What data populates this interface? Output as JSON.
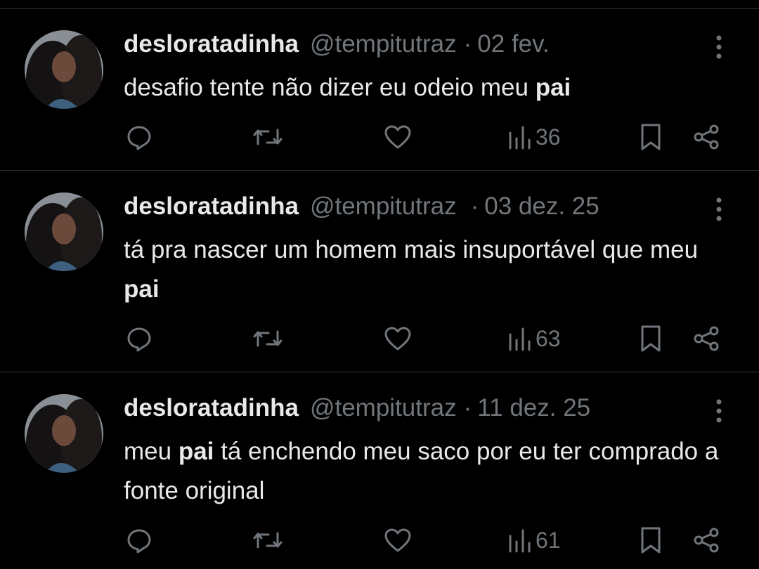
{
  "tweets": [
    {
      "display_name": "desloratadinha",
      "handle": "@tempitutraz",
      "separator": "·",
      "date": "02 fev.",
      "text_parts": [
        "desafio tente não dizer eu odeio meu ",
        "pai",
        ""
      ],
      "views": "36"
    },
    {
      "display_name": "desloratadinha",
      "handle": "@tempitutraz",
      "separator": "·",
      "date": "03 dez. 25",
      "text_parts": [
        "tá pra nascer um homem mais insuportável que meu ",
        "pai",
        ""
      ],
      "views": "63"
    },
    {
      "display_name": "desloratadinha",
      "handle": "@tempitutraz",
      "separator": "·",
      "date": "11 dez. 25",
      "text_parts": [
        "meu ",
        "pai",
        " tá enchendo meu saco por eu ter comprado a fonte original"
      ],
      "views": "61"
    }
  ],
  "icons": {
    "reply": "reply-icon",
    "retweet": "retweet-icon",
    "like": "heart-icon",
    "views": "views-chart-icon",
    "bookmark": "bookmark-icon",
    "share": "share-icon",
    "more": "more-vertical-icon"
  },
  "colors": {
    "background": "#000000",
    "primary_text": "#e7e9ea",
    "secondary_text": "#71767b",
    "divider": "#2f3336"
  }
}
